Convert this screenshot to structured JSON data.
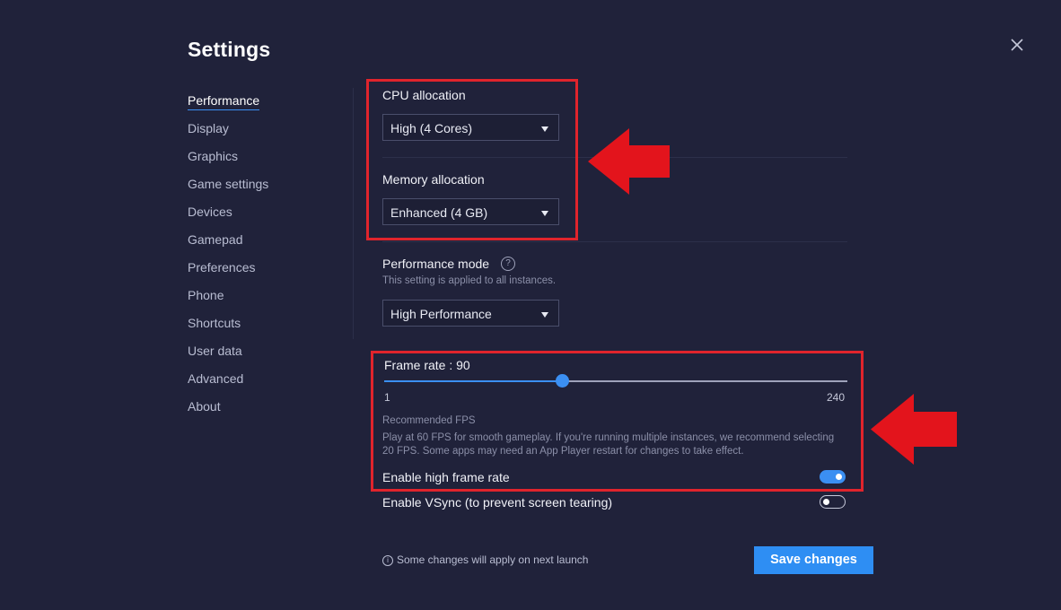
{
  "header": {
    "title": "Settings"
  },
  "close_icon": "close-icon",
  "sidebar": {
    "items": [
      {
        "label": "Performance",
        "active": true
      },
      {
        "label": "Display"
      },
      {
        "label": "Graphics"
      },
      {
        "label": "Game settings"
      },
      {
        "label": "Devices"
      },
      {
        "label": "Gamepad"
      },
      {
        "label": "Preferences"
      },
      {
        "label": "Phone"
      },
      {
        "label": "Shortcuts"
      },
      {
        "label": "User data"
      },
      {
        "label": "Advanced"
      },
      {
        "label": "About"
      }
    ]
  },
  "performance": {
    "cpu": {
      "label": "CPU allocation",
      "value": "High (4 Cores)"
    },
    "memory": {
      "label": "Memory allocation",
      "value": "Enhanced (4 GB)"
    },
    "mode": {
      "label": "Performance mode",
      "help": "?",
      "subtitle": "This setting is applied to all instances.",
      "value": "High Performance"
    },
    "frame_rate": {
      "label": "Frame rate : 90",
      "value": 90,
      "min": 1,
      "max": 240,
      "min_label": "1",
      "max_label": "240",
      "recommended_title": "Recommended FPS",
      "recommended_text": "Play at 60 FPS for smooth gameplay. If you're running multiple instances, we recommend selecting 20 FPS. Some apps may need an App Player restart for changes to take effect."
    },
    "high_frame_rate": {
      "label": "Enable high frame rate",
      "enabled": true
    },
    "vsync": {
      "label": "Enable VSync (to prevent screen tearing)",
      "enabled": false
    }
  },
  "footer": {
    "note_icon": "i",
    "note": "Some changes will apply on next launch",
    "save_label": "Save changes"
  },
  "colors": {
    "accent": "#2e8ef3",
    "highlight": "#e0242c",
    "background": "#20223a"
  }
}
